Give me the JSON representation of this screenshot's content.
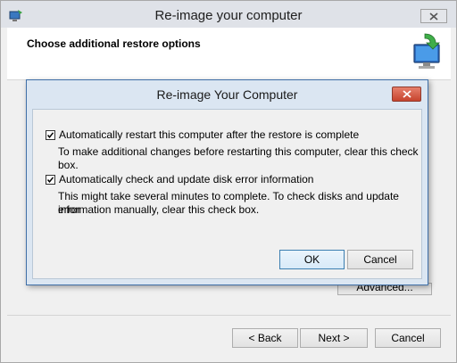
{
  "window": {
    "title": "Re-image your computer",
    "header_title": "Choose additional restore options"
  },
  "background_buttons": {
    "advanced": "Advanced..."
  },
  "footer": {
    "back": "< Back",
    "next": "Next >",
    "cancel": "Cancel"
  },
  "dialog": {
    "title": "Re-image Your Computer",
    "options": [
      {
        "label": "Automatically restart this computer after the restore is complete",
        "description": "To make additional changes before restarting this computer, clear this check box.",
        "checked": true
      },
      {
        "label": "Automatically check and update disk error information",
        "description_line1": "This might take several minutes to complete. To check disks and update error",
        "description_line2": "information manually, clear this check box.",
        "checked": true
      }
    ],
    "ok": "OK",
    "cancel": "Cancel"
  },
  "icons": {
    "app": "restore-app-icon",
    "header": "computer-restore-icon",
    "close": "close-icon",
    "check": "checkmark-icon"
  },
  "colors": {
    "dialog_border": "#3f6fa7",
    "dialog_bg": "#dbe6f2",
    "close_red": "#c7442e",
    "ok_border": "#3c7fb1"
  }
}
